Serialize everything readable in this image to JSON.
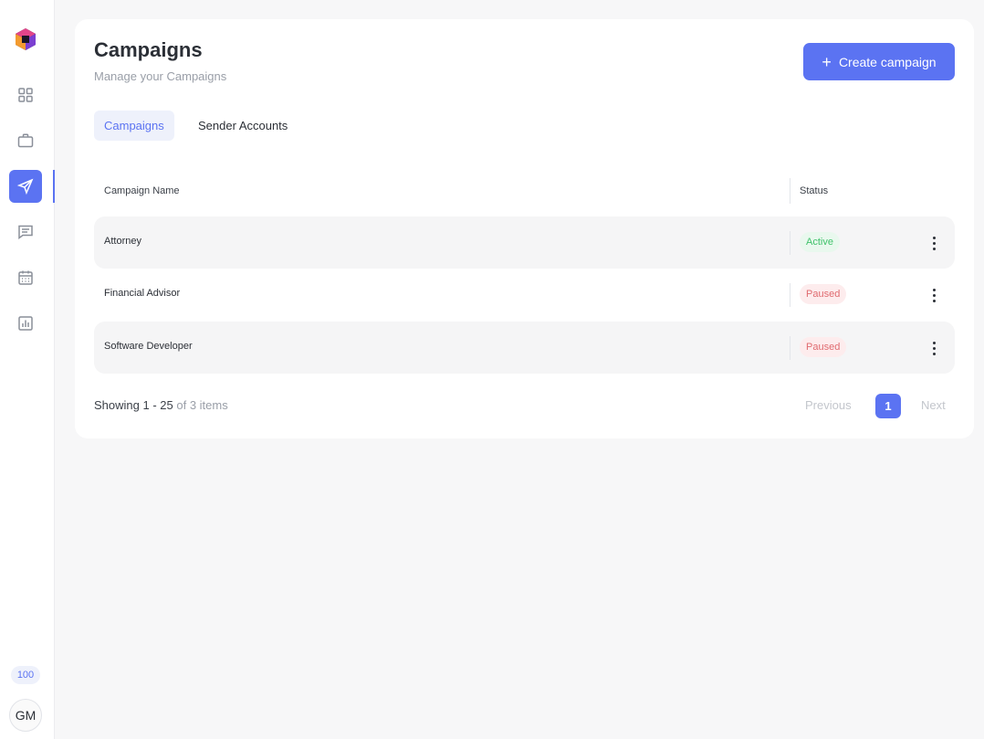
{
  "sidebar": {
    "items": [
      {
        "icon": "grid-icon"
      },
      {
        "icon": "briefcase-icon"
      },
      {
        "icon": "send-icon",
        "active": true
      },
      {
        "icon": "message-icon"
      },
      {
        "icon": "calendar-icon"
      },
      {
        "icon": "bar-chart-icon"
      }
    ],
    "credits": "100",
    "avatar_initials": "GM"
  },
  "header": {
    "title": "Campaigns",
    "subtitle": "Manage your Campaigns",
    "create_button": "Create campaign"
  },
  "tabs": [
    {
      "label": "Campaigns",
      "active": true
    },
    {
      "label": "Sender Accounts",
      "active": false
    }
  ],
  "table": {
    "columns": [
      "Campaign Name",
      "Status"
    ],
    "rows": [
      {
        "name": "Attorney",
        "status": "Active"
      },
      {
        "name": "Financial Advisor",
        "status": "Paused"
      },
      {
        "name": "Software Developer",
        "status": "Paused"
      }
    ]
  },
  "pagination": {
    "showing_prefix": "Showing 1 - 25",
    "showing_suffix": "of 3 items",
    "previous": "Previous",
    "current_page": "1",
    "next": "Next"
  },
  "colors": {
    "accent": "#5b73f2",
    "active_status": "#40c26b",
    "paused_status": "#e06b70"
  }
}
